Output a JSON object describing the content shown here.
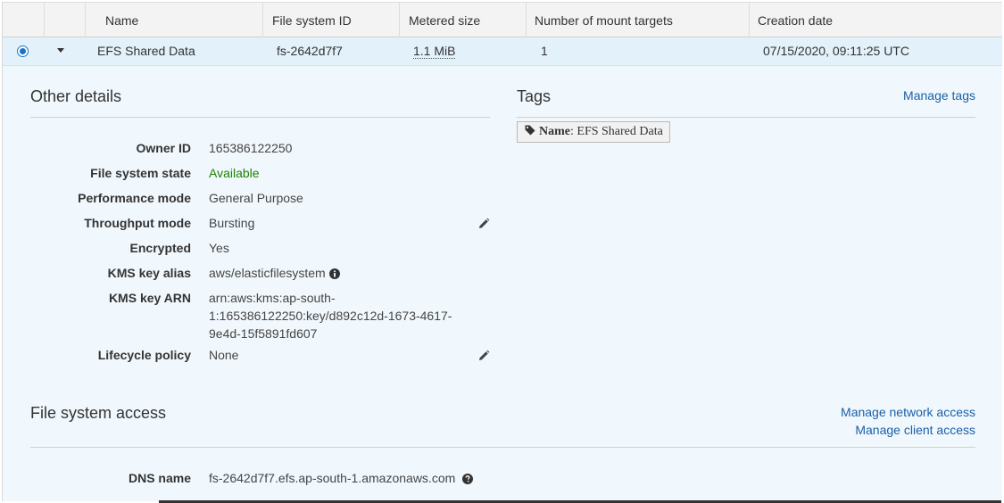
{
  "table": {
    "columns": [
      "Name",
      "File system ID",
      "Metered size",
      "Number of mount targets",
      "Creation date"
    ],
    "row": {
      "name": "EFS Shared Data",
      "file_system_id": "fs-2642d7f7",
      "metered_size": "1.1 MiB",
      "mount_targets": "1",
      "creation_date": "07/15/2020, 09:11:25 UTC",
      "selected": true,
      "expanded": true
    }
  },
  "other_details": {
    "title": "Other details",
    "items": [
      {
        "label": "Owner ID",
        "value": "165386122250"
      },
      {
        "label": "File system state",
        "value": "Available"
      },
      {
        "label": "Performance mode",
        "value": "General Purpose"
      },
      {
        "label": "Throughput mode",
        "value": "Bursting"
      },
      {
        "label": "Encrypted",
        "value": "Yes"
      },
      {
        "label": "KMS key alias",
        "value": "aws/elasticfilesystem"
      },
      {
        "label": "KMS key ARN",
        "value": "arn:aws:kms:ap-south-1:165386122250:key/d892c12d-1673-4617-9e4d-15f5891fd607"
      },
      {
        "label": "Lifecycle policy",
        "value": "None"
      }
    ]
  },
  "tags": {
    "title": "Tags",
    "manage_link": "Manage tags",
    "chip_key": "Name",
    "chip_value": ": EFS Shared Data"
  },
  "access": {
    "title": "File system access",
    "manage_network": "Manage network access",
    "manage_client": "Manage client access",
    "dns_label": "DNS name",
    "dns_value": "fs-2642d7f7.efs.ap-south-1.amazonaws.com"
  },
  "colors": {
    "link": "#1a5fa8",
    "available": "#1d8102",
    "selected_row": "#e3f1fb",
    "panel": "#f1f8fd"
  },
  "icons": [
    "radio-selected-icon",
    "caret-down-icon",
    "pencil-icon",
    "info-icon",
    "tag-icon",
    "help-icon"
  ]
}
